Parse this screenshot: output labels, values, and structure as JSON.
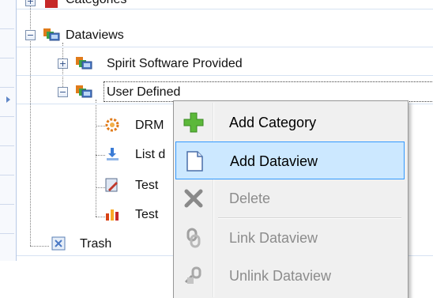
{
  "tree": {
    "categories_label": "Categories",
    "dataviews_label": "Dataviews",
    "spirit_label": "Spirit Software Provided",
    "user_defined_label": "User Defined",
    "children": [
      {
        "label": "DRM",
        "icon": "gear-flower-icon"
      },
      {
        "label": "List d",
        "icon": "pin-download-icon"
      },
      {
        "label": "Test",
        "icon": "pencil-doc-icon"
      },
      {
        "label": "Test",
        "icon": "chart-icon"
      }
    ],
    "trash_label": "Trash",
    "expanders": {
      "plus": "+",
      "minus": "−"
    }
  },
  "context_menu": {
    "items": [
      {
        "label": "Add Category",
        "icon": "plus-icon",
        "enabled": true,
        "highlighted": false
      },
      {
        "label": "Add Dataview",
        "icon": "document-icon",
        "enabled": true,
        "highlighted": true
      },
      {
        "label": "Delete",
        "icon": "x-icon",
        "enabled": false,
        "highlighted": false
      },
      {
        "label": "Link Dataview",
        "icon": "link-icon",
        "enabled": false,
        "highlighted": false
      },
      {
        "label": "Unlink Dataview",
        "icon": "unlink-icon",
        "enabled": false,
        "highlighted": false
      }
    ]
  },
  "colors": {
    "highlight_bg": "#cce8ff",
    "highlight_border": "#3399ff",
    "menu_bg": "#f0f0f0",
    "disabled_text": "#8c8c8c",
    "grid_line": "#d6e2f2"
  }
}
